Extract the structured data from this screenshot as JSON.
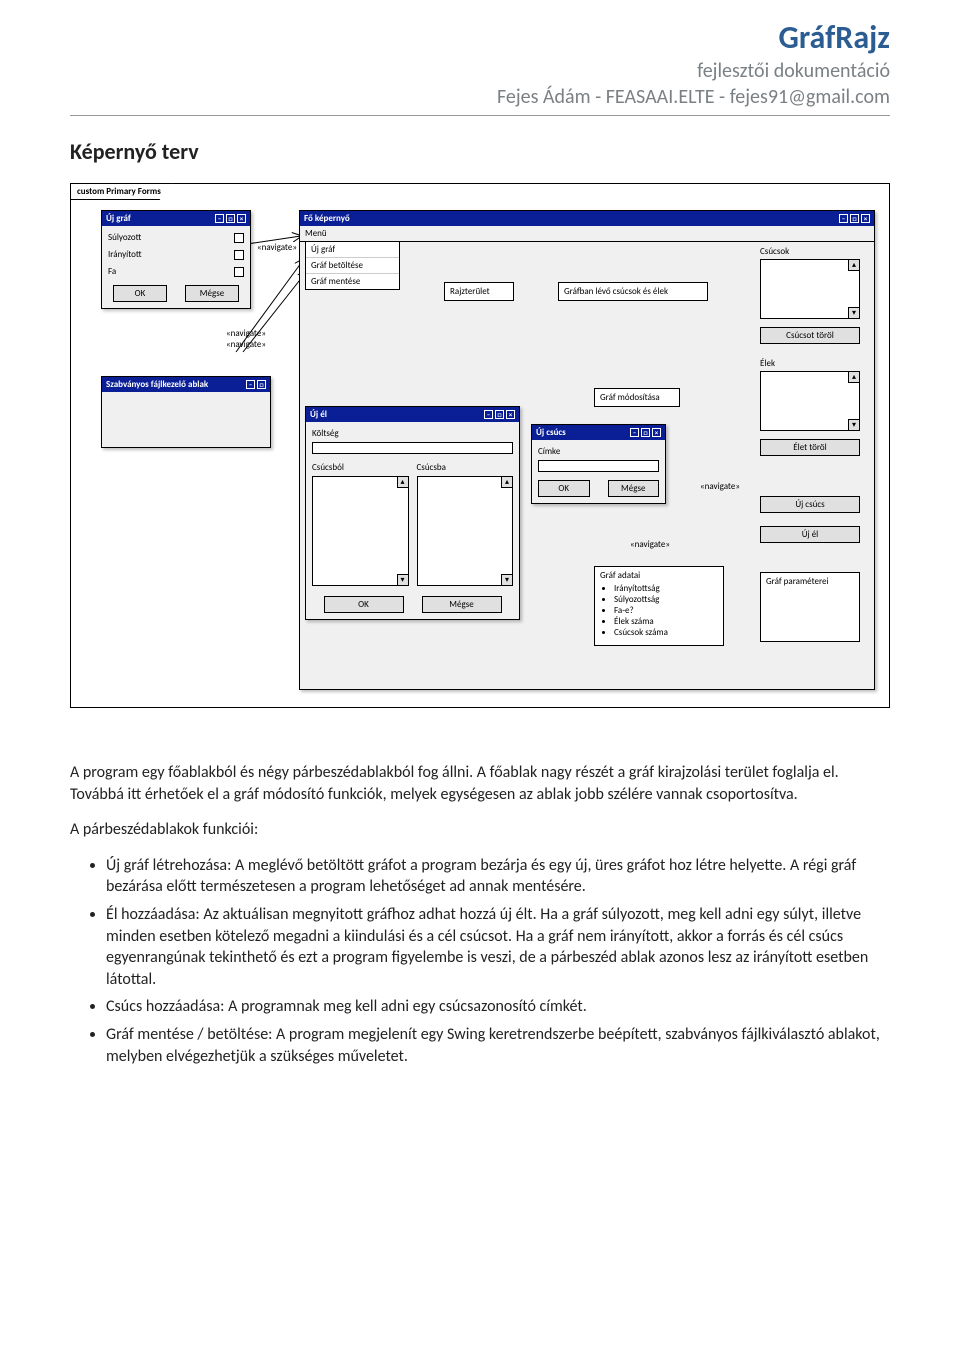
{
  "header": {
    "title": "GráfRajz",
    "subtitle": "fejlesztői dokumentáció",
    "author": "Fejes Ádám - FEASAAI.ELTE - fejes91@gmail.com"
  },
  "section_heading": "Képernyő terv",
  "frame_tab": "custom Primary Forms",
  "dlg_uj_graf": {
    "title": "Új gráf",
    "opt_sulyozott": "Súlyozott",
    "opt_iranyitott": "Irányított",
    "opt_fa": "Fa",
    "btn_ok": "OK",
    "btn_cancel": "Mégse"
  },
  "main_window": {
    "title": "Fő képernyő",
    "menu": "Menü",
    "mi_uj_graf": "Új gráf",
    "mi_betolt": "Gráf betöltése",
    "mi_mentes": "Gráf mentése",
    "rajzterulet": "Rajzterület",
    "graf_list_header": "Gráfban lévő csúcsok és élek",
    "graf_mod": "Gráf módosítása",
    "csucsok": "Csúcsok",
    "csucsot_torol": "Csúcsot töröl",
    "elek": "Élek",
    "elet_torol": "Élet töröl",
    "uj_csucs": "Új csúcs",
    "uj_el": "Új él",
    "graf_adatai_title": "Gráf adatai",
    "graf_adatai_items": [
      "Irányítottság",
      "Súlyozottság",
      "Fa-e?",
      "Élek száma",
      "Csúcsok száma"
    ],
    "graf_params": "Gráf paraméterei"
  },
  "file_dlg_title": "Szabványos fájlkezelő ablak",
  "dlg_uj_el": {
    "title": "Új él",
    "koltseg": "Költség",
    "csucsbol": "Csúcsból",
    "csucsba": "Csúcsba",
    "btn_ok": "OK",
    "btn_cancel": "Mégse"
  },
  "dlg_uj_csucs": {
    "title": "Új csúcs",
    "cimke": "Címke",
    "btn_ok": "OK",
    "btn_cancel": "Mégse"
  },
  "nav_label": "«navigate»",
  "para1": "A program egy főablakból és négy párbeszédablakból fog állni. A főablak nagy részét a gráf kirajzolási terület foglalja el. Továbbá itt érhetőek el a gráf módosító funkciók, melyek egységesen az ablak jobb szélére vannak csoportosítva.",
  "para2": "A párbeszédablakok funkciói:",
  "bullets": [
    "Új gráf létrehozása: A meglévő betöltött gráfot a program bezárja és egy új, üres gráfot hoz létre helyette. A régi gráf bezárása előtt természetesen a program lehetőséget ad annak mentésére.",
    "Él hozzáadása: Az aktuálisan megnyitott gráfhoz adhat hozzá új élt. Ha a gráf súlyozott, meg kell adni egy súlyt, illetve minden esetben kötelező megadni a kiindulási és a cél csúcsot. Ha a gráf nem irányított, akkor a forrás és cél csúcs egyenrangúnak tekinthető és ezt a program figyelembe is veszi, de a párbeszéd ablak azonos lesz az irányított esetben látottal.",
    "Csúcs hozzáadása: A programnak meg kell adni egy csúcsazonosító címkét.",
    "Gráf mentése / betöltése: A program megjelenít egy Swing keretrendszerbe beépített, szabványos fájlkiválasztó ablakot, melyben elvégezhetjük a szükséges műveletet."
  ]
}
